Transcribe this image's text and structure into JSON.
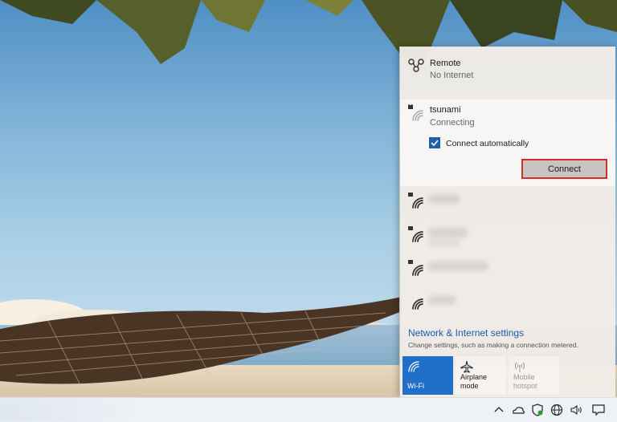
{
  "networks": {
    "remote": {
      "name": "Remote",
      "status": "No Internet",
      "icon": "network-globe-icon"
    },
    "tsunami": {
      "name": "tsunami",
      "status": "Connecting",
      "secured": true,
      "connect_automatically_label": "Connect automatically",
      "connect_automatically_checked": true,
      "connect_label": "Connect"
    },
    "other_networks_count": 4
  },
  "settings": {
    "title": "Network & Internet settings",
    "description": "Change settings, such as making a connection metered."
  },
  "quick_actions": [
    {
      "label": "Wi-Fi",
      "icon": "wifi-icon",
      "active": true
    },
    {
      "label": "Airplane mode",
      "icon": "airplane-icon",
      "active": false
    },
    {
      "label": "Mobile hotspot",
      "icon": "hotspot-icon",
      "active": false,
      "disabled": true
    }
  ],
  "taskbar": {
    "tray_icons": [
      "chevron-up-icon",
      "onedrive-icon",
      "defender-icon",
      "network-icon",
      "volume-icon",
      "notification-icon"
    ]
  },
  "colors": {
    "accent": "#1f6fc8",
    "highlight_border": "#d52c2c",
    "link": "#1a5aa6"
  }
}
